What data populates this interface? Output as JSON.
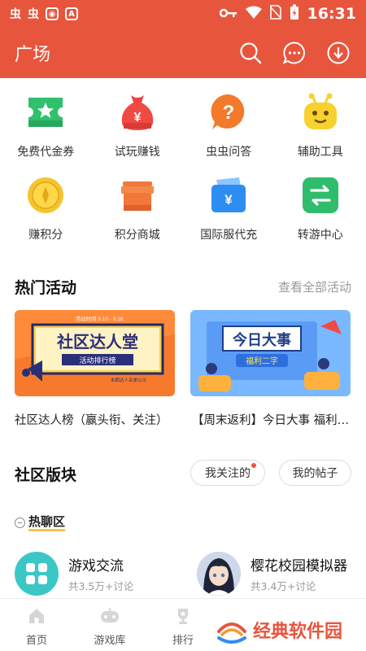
{
  "status_bar": {
    "time": "16:31",
    "left_glyphs": [
      "虫",
      "虫"
    ]
  },
  "app_bar": {
    "title": "广场"
  },
  "quick_grid": [
    {
      "label": "免费代金券",
      "icon": "ticket-icon",
      "color": "#2fc16c"
    },
    {
      "label": "试玩赚钱",
      "icon": "money-bag-icon",
      "color": "#ef4b44"
    },
    {
      "label": "虫虫问答",
      "icon": "question-icon",
      "color": "#f27a2a"
    },
    {
      "label": "辅助工具",
      "icon": "robot-icon",
      "color": "#f7d12e"
    },
    {
      "label": "赚积分",
      "icon": "coin-icon",
      "color": "#f5c32c"
    },
    {
      "label": "积分商城",
      "icon": "store-icon",
      "color": "#f2773a"
    },
    {
      "label": "国际服代充",
      "icon": "wallet-icon",
      "color": "#2e8df0"
    },
    {
      "label": "转游中心",
      "icon": "transfer-icon",
      "color": "#2fbd6c"
    }
  ],
  "hot_events": {
    "title": "热门活动",
    "more_label": "查看全部活动",
    "banners": [
      {
        "caption": "社区达人榜（赢头衔、关注）",
        "art_title": "社区达人堂",
        "art_subtitle": "活动排行榜",
        "art_date": "活动时间 9.10 - 9.16",
        "art_tag": "本期达人名单公示"
      },
      {
        "caption": "【周末返利】今日大事 福利二字",
        "art_title": "今日大事",
        "art_subtitle": "福利二字"
      }
    ]
  },
  "community": {
    "title": "社区版块",
    "pills": [
      "我关注的",
      "我的帖子"
    ],
    "section_label": "热聊区",
    "forums": [
      {
        "name": "游戏交流",
        "count": "共3.5万+讨论",
        "icon": "grid-icon"
      },
      {
        "name": "樱花校园模拟器",
        "count": "共3.4万+讨论",
        "icon": "anime-avatar-icon"
      }
    ]
  },
  "tabs": [
    {
      "label": "首页",
      "icon": "home-icon"
    },
    {
      "label": "游戏库",
      "icon": "gamepad-icon"
    },
    {
      "label": "排行",
      "icon": "trophy-icon"
    }
  ],
  "watermark": {
    "text": "经典软件园"
  },
  "colors": {
    "primary": "#e8553d",
    "text": "#222222",
    "muted": "#999999"
  }
}
